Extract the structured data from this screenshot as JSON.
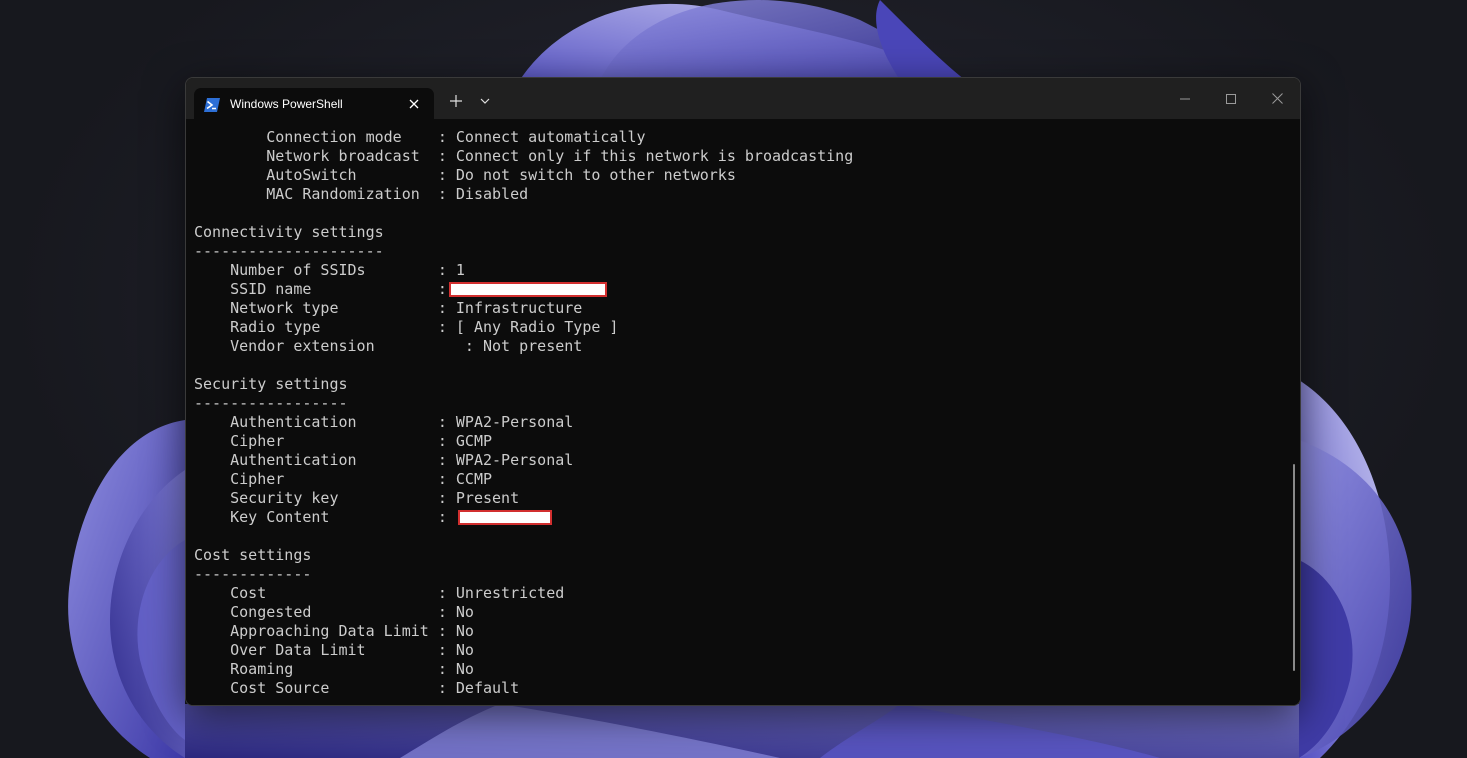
{
  "window": {
    "tab_title": "Windows PowerShell",
    "new_tab_symbol": "+",
    "dropdown_symbol": "⌄"
  },
  "terminal": {
    "lines": [
      {
        "type": "text",
        "text": "        Connection mode    : Connect automatically"
      },
      {
        "type": "text",
        "text": "        Network broadcast  : Connect only if this network is broadcasting"
      },
      {
        "type": "text",
        "text": "        AutoSwitch         : Do not switch to other networks"
      },
      {
        "type": "text",
        "text": "        MAC Randomization  : Disabled"
      },
      {
        "type": "text",
        "text": ""
      },
      {
        "type": "text",
        "text": "Connectivity settings"
      },
      {
        "type": "text",
        "text": "---------------------"
      },
      {
        "type": "text",
        "text": "    Number of SSIDs        : 1"
      },
      {
        "type": "redacted",
        "text": "    SSID name              :",
        "redact_chars": 17
      },
      {
        "type": "text",
        "text": "    Network type           : Infrastructure"
      },
      {
        "type": "text",
        "text": "    Radio type             : [ Any Radio Type ]"
      },
      {
        "type": "text",
        "text": "    Vendor extension          : Not present"
      },
      {
        "type": "text",
        "text": ""
      },
      {
        "type": "text",
        "text": "Security settings"
      },
      {
        "type": "text",
        "text": "-----------------"
      },
      {
        "type": "text",
        "text": "    Authentication         : WPA2-Personal"
      },
      {
        "type": "text",
        "text": "    Cipher                 : GCMP"
      },
      {
        "type": "text",
        "text": "    Authentication         : WPA2-Personal"
      },
      {
        "type": "text",
        "text": "    Cipher                 : CCMP"
      },
      {
        "type": "text",
        "text": "    Security key           : Present"
      },
      {
        "type": "redacted",
        "text": "    Key Content            : ",
        "redact_chars": 10
      },
      {
        "type": "text",
        "text": ""
      },
      {
        "type": "text",
        "text": "Cost settings"
      },
      {
        "type": "text",
        "text": "-------------"
      },
      {
        "type": "text",
        "text": "    Cost                   : Unrestricted"
      },
      {
        "type": "text",
        "text": "    Congested              : No"
      },
      {
        "type": "text",
        "text": "    Approaching Data Limit : No"
      },
      {
        "type": "text",
        "text": "    Over Data Limit        : No"
      },
      {
        "type": "text",
        "text": "    Roaming                : No"
      },
      {
        "type": "text",
        "text": "    Cost Source            : Default"
      }
    ]
  },
  "colors": {
    "terminal_bg": "#0c0c0c",
    "terminal_fg": "#cccccc",
    "titlebar_bg": "#202020",
    "redaction_border": "#d22f2f"
  }
}
